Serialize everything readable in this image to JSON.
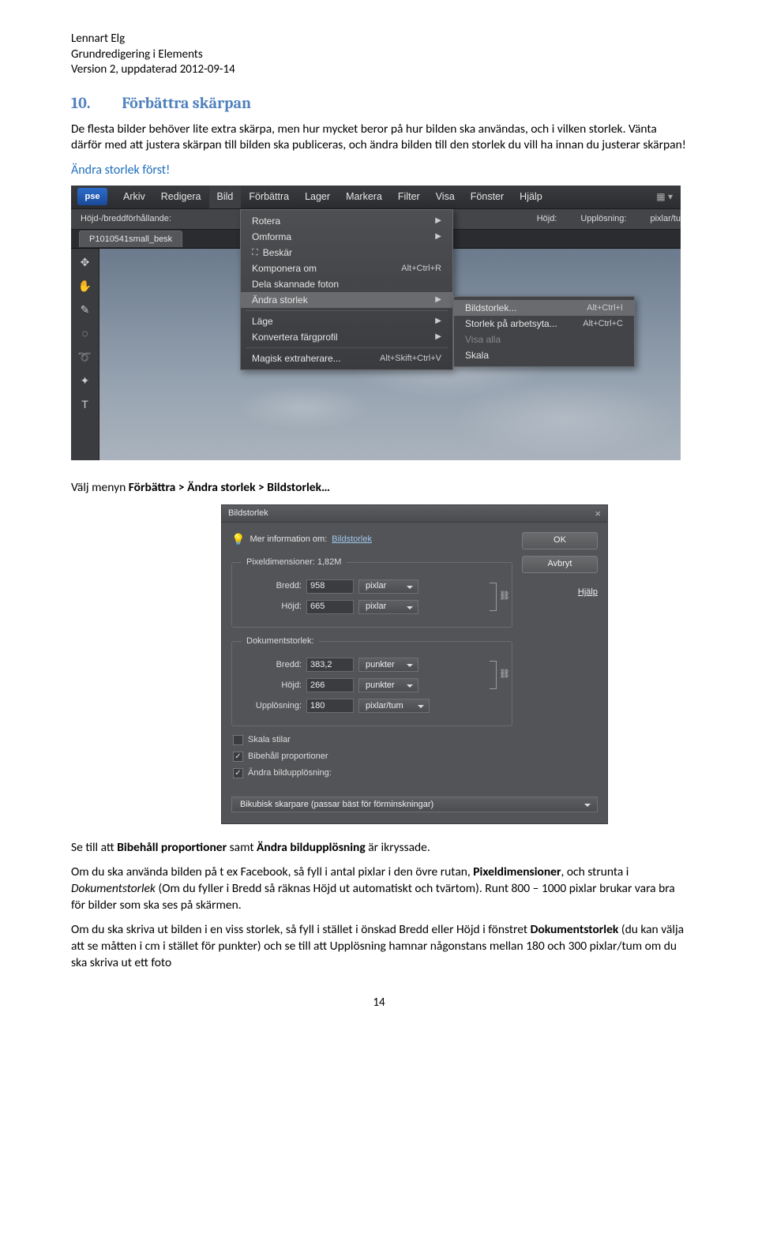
{
  "doc_header": {
    "author": "Lennart Elg",
    "title": "Grundredigering  i Elements",
    "version": "Version 2, uppdaterad 2012-09-14"
  },
  "section": {
    "number": "10.",
    "title": "Förbättra skärpan"
  },
  "para1": "De flesta bilder behöver lite extra skärpa, men hur mycket beror på hur bilden ska användas, och i vilken storlek. Vänta därför med att justera skärpan till bilden ska publiceras, och ändra bilden till den storlek du vill ha innan du justerar skärpan!",
  "blue_note": "Ändra storlek först!",
  "shot1": {
    "logo": "pse",
    "menus": [
      "Arkiv",
      "Redigera",
      "Bild",
      "Förbättra",
      "Lager",
      "Markera",
      "Filter",
      "Visa",
      "Fönster",
      "Hjälp"
    ],
    "options": {
      "ratio": "Höjd-/breddförhållande:",
      "hojd": "Höjd:",
      "uppl": "Upplösning:",
      "unit": "pixlar/tu"
    },
    "tab": "P1010541small_besk",
    "tab_close": "×",
    "icon_widget": "▦ ▾",
    "dropdown": [
      {
        "label": "Rotera",
        "arrow": true
      },
      {
        "label": "Omforma",
        "arrow": true
      },
      {
        "label": "Beskär",
        "crop": true
      },
      {
        "label": "Komponera om",
        "shortcut": "Alt+Ctrl+R"
      },
      {
        "label": "Dela skannade foton"
      },
      {
        "label": "Ändra storlek",
        "arrow": true,
        "hl": true
      },
      {
        "sep": true
      },
      {
        "label": "Läge",
        "arrow": true
      },
      {
        "label": "Konvertera färgprofil",
        "arrow": true
      },
      {
        "sep": true
      },
      {
        "label": "Magisk extraherare...",
        "shortcut": "Alt+Skift+Ctrl+V"
      }
    ],
    "submenu": [
      {
        "label": "Bildstorlek...",
        "shortcut": "Alt+Ctrl+I",
        "hl": true
      },
      {
        "label": "Storlek på arbetsyta...",
        "shortcut": "Alt+Ctrl+C"
      },
      {
        "label": "Visa alla",
        "dim": true
      },
      {
        "label": "Skala"
      }
    ]
  },
  "mid_text_pre": "Välj menyn ",
  "mid_text_bold": "Förbättra > Ändra storlek > Bildstorlek…",
  "shot2": {
    "title": "Bildstorlek",
    "info_label": "Mer information om:",
    "info_link": "Bildstorlek",
    "buttons": {
      "ok": "OK",
      "cancel": "Avbryt",
      "help": "Hjälp"
    },
    "fs1": {
      "legend": "Pixeldimensioner: 1,82M",
      "width_lbl": "Bredd:",
      "width_val": "958",
      "width_unit": "pixlar",
      "height_lbl": "Höjd:",
      "height_val": "665",
      "height_unit": "pixlar"
    },
    "fs2": {
      "legend": "Dokumentstorlek:",
      "width_lbl": "Bredd:",
      "width_val": "383,2",
      "width_unit": "punkter",
      "height_lbl": "Höjd:",
      "height_val": "266",
      "height_unit": "punkter",
      "res_lbl": "Upplösning:",
      "res_val": "180",
      "res_unit": "pixlar/tum"
    },
    "checks": {
      "scale": {
        "label": "Skala stilar",
        "checked": false
      },
      "prop": {
        "label": "Bibehåll proportioner",
        "checked": true
      },
      "resamp": {
        "label": "Ändra bildupplösning:",
        "checked": true
      }
    },
    "resample_method": "Bikubisk skarpare (passar bäst för förminskningar)"
  },
  "para2_pre": "Se till att ",
  "para2_b1": "Bibehåll proportioner",
  "para2_mid": " samt ",
  "para2_b2": "Ändra bildupplösning",
  "para2_post": " är ikryssade.",
  "para3_a": "Om du ska använda bilden på t ex Facebook, så fyll i antal pixlar i den övre rutan, ",
  "para3_b": "Pixeldimensioner",
  "para3_c": ", och strunta i ",
  "para3_d": "Dokumentstorlek",
  "para3_e": " (Om du fyller i Bredd så räknas Höjd ut automatiskt och tvärtom). Runt 800 – 1000 pixlar brukar vara bra för bilder som ska ses på skärmen.",
  "para4_a": "Om du ska skriva ut bilden i en viss storlek, så fyll i stället i önskad Bredd eller Höjd i fönstret ",
  "para4_b": "Dokumentstorlek",
  "para4_c": " (du kan välja att se måtten i cm i stället för punkter) och se till att Upplösning hamnar någonstans mellan 180 och 300 pixlar/tum om du ska skriva ut ett foto",
  "page_number": "14"
}
